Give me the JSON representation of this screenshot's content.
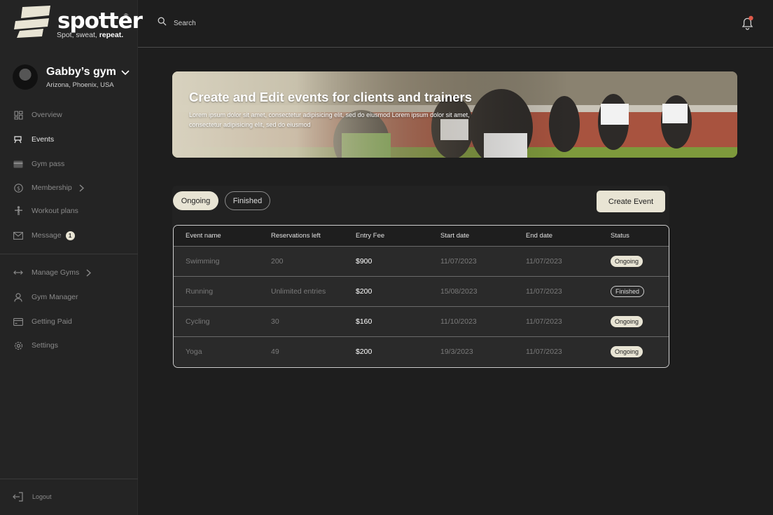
{
  "brand": {
    "name": "spotter",
    "registered": "®",
    "tagline_part1": "Spot, sweat, ",
    "tagline_part2": "repeat."
  },
  "gym": {
    "name": "Gabby’s gym",
    "location": "Arizona, Phoenix, USA"
  },
  "nav": [
    {
      "label": "Overview",
      "icon": "overview-icon"
    },
    {
      "label": "Events",
      "icon": "events-icon",
      "active": true
    },
    {
      "label": "Gym pass",
      "icon": "card-icon"
    },
    {
      "label": "Membership",
      "icon": "dollar-icon"
    },
    {
      "label": "Workout plans",
      "icon": "workout-icon"
    },
    {
      "label": "Message",
      "icon": "mail-icon",
      "badge": "1"
    }
  ],
  "nav2": [
    {
      "label": "Manage Gyms",
      "icon": "arrows-icon"
    },
    {
      "label": "Gym Manager",
      "icon": "user-icon"
    },
    {
      "label": "Getting Paid",
      "icon": "card-icon"
    },
    {
      "label": "Settings",
      "icon": "gear-icon"
    }
  ],
  "logout_label": "Logout",
  "search": {
    "placeholder": "Search"
  },
  "banner": {
    "title": "Create and Edit events for clients and trainers",
    "text": "Lorem ipsum dolor sit amet, consectetur adipisicing elit, sed do eiusmod Lorem ipsum dolor sit amet, consectetur adipisicing elit, sed do eiusmod"
  },
  "tabs": {
    "ongoing": "Ongoing",
    "finished": "Finished"
  },
  "create_event": "Create Event",
  "table": {
    "headers": [
      "Event name",
      "Reservations left",
      "Entry Fee",
      "Start date",
      "End date",
      "Status"
    ],
    "rows": [
      {
        "name": "Swimming",
        "reservations": "200",
        "fee": "$900",
        "start": "11/07/2023",
        "end": "11/07/2023",
        "status": "Ongoing"
      },
      {
        "name": "Running",
        "reservations": "Unlimited entries",
        "fee": "$200",
        "start": "15/08/2023",
        "end": "11/07/2023",
        "status": "Finished"
      },
      {
        "name": "Cycling",
        "reservations": "30",
        "fee": "$160",
        "start": "11/10/2023",
        "end": "11/07/2023",
        "status": "Ongoing"
      },
      {
        "name": "Yoga",
        "reservations": "49",
        "fee": "$200",
        "start": "19/3/2023",
        "end": "11/07/2023",
        "status": "Ongoing"
      }
    ]
  },
  "colors": {
    "accent": "#e8e4d4",
    "background": "#1e1e1e",
    "sidebar": "#242424",
    "notification": "#e05a4a"
  }
}
